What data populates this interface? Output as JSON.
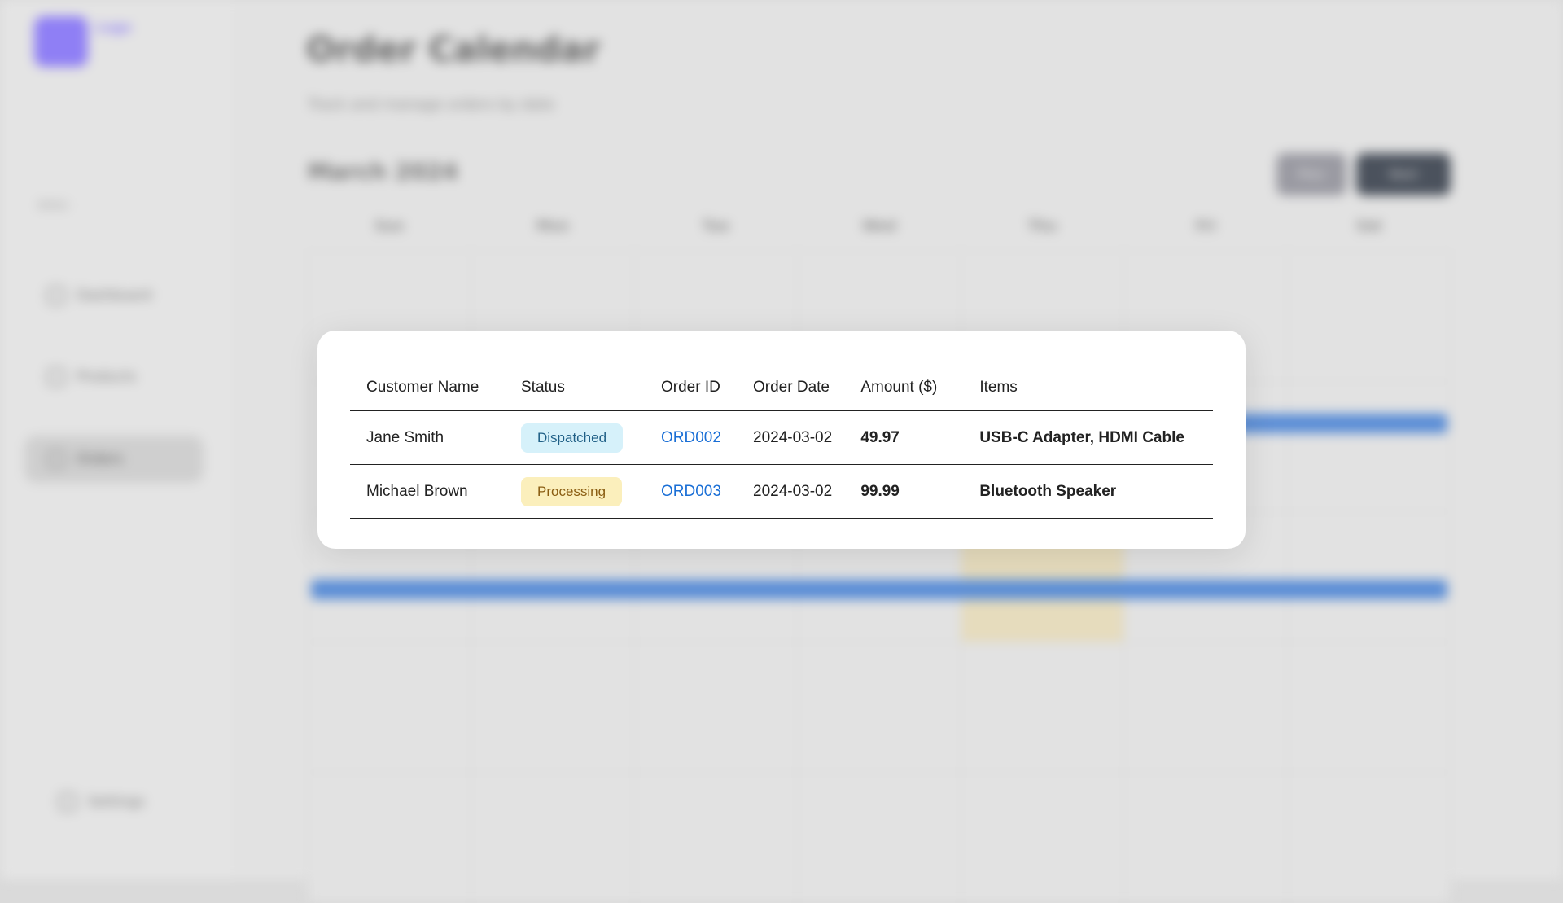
{
  "background": {
    "sidebar": {
      "logo": "Logo",
      "section_label": "MENU",
      "items": [
        {
          "label": "Dashboard",
          "icon": "grid-icon"
        },
        {
          "label": "Products",
          "icon": "box-icon"
        },
        {
          "label": "Orders",
          "icon": "calendar-icon",
          "active": true
        }
      ],
      "settings_label": "Settings"
    },
    "header": {
      "title": "Order Calendar",
      "subtitle": "Track and manage orders by date"
    },
    "calendar": {
      "month_label": "March 2024",
      "prev_label": "Prev",
      "next_label": "Next",
      "weekdays": [
        "Sun",
        "Mon",
        "Tue",
        "Wed",
        "Thu",
        "Fri",
        "Sat"
      ]
    }
  },
  "modal": {
    "columns": [
      "Customer Name",
      "Status",
      "Order ID",
      "Order Date",
      "Amount ($)",
      "Items"
    ],
    "rows": [
      {
        "customer": "Jane Smith",
        "status": "Dispatched",
        "order_id": "ORD002",
        "date": "2024-03-02",
        "amount": "49.97",
        "items": "USB-C Adapter, HDMI Cable"
      },
      {
        "customer": "Michael Brown",
        "status": "Processing",
        "order_id": "ORD003",
        "date": "2024-03-02",
        "amount": "99.99",
        "items": "Bluetooth Speaker"
      }
    ]
  },
  "colors": {
    "dispatched_bg": "#d6f1fa",
    "dispatched_text": "#1f5f86",
    "processing_bg": "#fbefbc",
    "processing_text": "#8a5d12",
    "link": "#1a6fd6",
    "accent": "#8f7ff5"
  }
}
